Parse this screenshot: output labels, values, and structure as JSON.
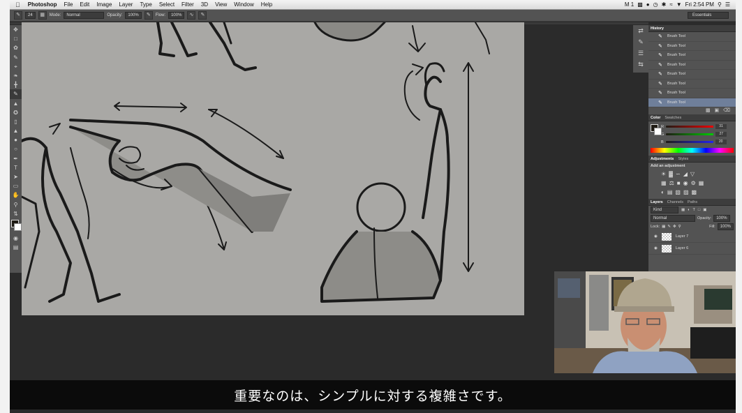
{
  "menubar": {
    "app_name": "Photoshop",
    "items": [
      "File",
      "Edit",
      "Image",
      "Layer",
      "Type",
      "Select",
      "Filter",
      "3D",
      "View",
      "Window",
      "Help"
    ],
    "clock": "Fri 2:54 PM",
    "status_text": "1"
  },
  "options": {
    "brush_size": "24",
    "mode_label": "Mode:",
    "mode_value": "Normal",
    "opacity_label": "Opacity:",
    "opacity_value": "100%",
    "flow_label": "Flow:",
    "flow_value": "100%",
    "workspace": "Essentials"
  },
  "panels": {
    "history": {
      "tab": "History",
      "items": [
        "Brush Tool",
        "Brush Tool",
        "Brush Tool",
        "Brush Tool",
        "Brush Tool",
        "Brush Tool",
        "Brush Tool",
        "Brush Tool"
      ],
      "selected_index": 7
    },
    "color": {
      "tabs": [
        "Color",
        "Swatches"
      ],
      "channels": [
        {
          "label": "R",
          "value": "31",
          "color": "#cc2222"
        },
        {
          "label": "G",
          "value": "27",
          "color": "#22aa22"
        },
        {
          "label": "B",
          "value": "20",
          "color": "#2233cc"
        }
      ]
    },
    "adjustments": {
      "tabs": [
        "Adjustments",
        "Styles"
      ],
      "heading": "Add an adjustment"
    },
    "layers": {
      "tabs": [
        "Layers",
        "Channels",
        "Paths"
      ],
      "kind": "Kind",
      "blend_mode": "Normal",
      "opacity_label": "Opacity:",
      "opacity_value": "100%",
      "lock_label": "Lock:",
      "fill_label": "Fill:",
      "fill_value": "100%",
      "items": [
        "Layer 7",
        "Layer 6"
      ]
    }
  },
  "subtitle": "重要なのは、シンプルに対する複雑さです。",
  "colors": {
    "canvas": "#a9a8a5",
    "panel": "#535353",
    "history_selected": "#6f7f9a"
  }
}
